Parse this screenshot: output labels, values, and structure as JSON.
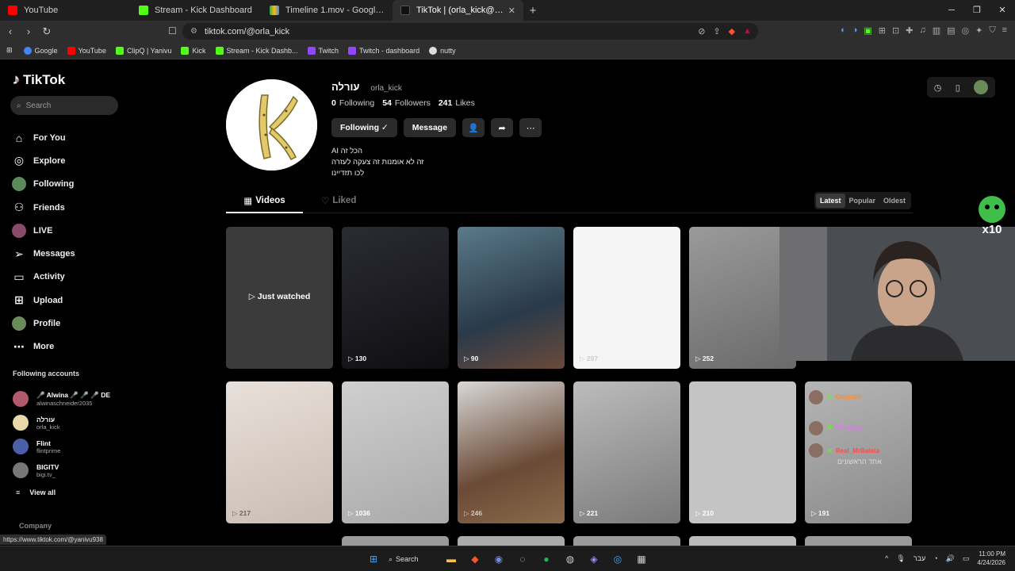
{
  "browser": {
    "tabs": [
      {
        "title": "YouTube",
        "color": "#ff0000"
      },
      {
        "title": "Stream - Kick Dashboard",
        "color": "#53fc18"
      },
      {
        "title": "Timeline 1.mov - Google Drive",
        "color": "#fbbc04"
      },
      {
        "title": "TikTok | (orla_kick@) עורלה",
        "color": "#111111"
      }
    ],
    "url": "tiktok.com/@orla_kick",
    "bookmarks": [
      {
        "label": "Google",
        "color": "#4285f4"
      },
      {
        "label": "YouTube",
        "color": "#ff0000"
      },
      {
        "label": "ClipQ | Yanivu",
        "color": "#53fc18"
      },
      {
        "label": "Kick",
        "color": "#53fc18"
      },
      {
        "label": "Stream - Kick Dashb...",
        "color": "#53fc18"
      },
      {
        "label": "Twitch",
        "color": "#9146ff"
      },
      {
        "label": "Twitch - dashboard",
        "color": "#9146ff"
      },
      {
        "label": "nutty",
        "color": "#dddddd"
      }
    ]
  },
  "sidebar": {
    "logo": "TikTok",
    "search_placeholder": "Search",
    "nav": [
      {
        "label": "For You",
        "icon": "home-icon"
      },
      {
        "label": "Explore",
        "icon": "compass-icon"
      },
      {
        "label": "Following",
        "icon": "avatar-icon"
      },
      {
        "label": "Friends",
        "icon": "friends-icon"
      },
      {
        "label": "LIVE",
        "icon": "avatar-icon"
      },
      {
        "label": "Messages",
        "icon": "paper-plane-icon"
      },
      {
        "label": "Activity",
        "icon": "inbox-icon"
      },
      {
        "label": "Upload",
        "icon": "plus-box-icon"
      },
      {
        "label": "Profile",
        "icon": "avatar-icon"
      },
      {
        "label": "More",
        "icon": "dots-icon"
      }
    ],
    "following_title": "Following accounts",
    "following": [
      {
        "name": "🎤 Alwina 🎤 🎤 🎤 DE",
        "handle": "alwinaschneider2035",
        "color": "#b25a6b"
      },
      {
        "name": "עורלה",
        "handle": "orla_kick",
        "color": "#e8d9a8"
      },
      {
        "name": "Flint",
        "handle": "flintprime",
        "color": "#4b5fa8"
      },
      {
        "name": "BIGITV",
        "handle": "bigi.tv_",
        "color": "#777777"
      }
    ],
    "view_all": "View all",
    "company": "Company"
  },
  "profile": {
    "name": "עורלה",
    "handle": "orla_kick",
    "following_count": "0",
    "following_label": "Following",
    "followers_count": "54",
    "followers_label": "Followers",
    "likes_count": "241",
    "likes_label": "Likes",
    "following_btn": "Following ✓",
    "message_btn": "Message",
    "bio": [
      "הכל זה AI",
      "זה לא אומנות זה צעקה לעזרה",
      "לכו תזדיינו"
    ]
  },
  "tabs": {
    "videos": "Videos",
    "liked": "Liked"
  },
  "sort": [
    "Latest",
    "Popular",
    "Oldest"
  ],
  "videos": [
    {
      "views": "",
      "label": "Just watched",
      "bg": "#3b3b3b"
    },
    {
      "views": "130",
      "bg": "#1c1c22"
    },
    {
      "views": "90",
      "bg": "#3a5c6e"
    },
    {
      "views": "297",
      "bg": "#f2f2f2"
    },
    {
      "views": "252",
      "bg": "#8a8a8a"
    },
    {
      "views": "",
      "bg": "#6e6e6e"
    },
    {
      "views": "217",
      "bg": "#d8cfc9"
    },
    {
      "views": "1036",
      "bg": "#b8b8b8"
    },
    {
      "views": "246",
      "bg": "#6b4a36"
    },
    {
      "views": "221",
      "bg": "#9c9c9c"
    },
    {
      "views": "210",
      "bg": "#c4c4c4"
    },
    {
      "views": "191",
      "bg": "#a9a9a9"
    }
  ],
  "chat": [
    {
      "user": "Quasi20",
      "color": "#ff8c2a"
    },
    {
      "user": "VPussyy",
      "color": "#e46fff"
    },
    {
      "user": "Real_MrBalata",
      "color": "#ff4a4a",
      "text": "אחד הראשונים"
    }
  ],
  "status_url": "https://www.tiktok.com/@yanivu938",
  "taskbar": {
    "search": "Search",
    "lang": "עבר",
    "time": "11:00 PM",
    "date": "4/24/2026"
  }
}
